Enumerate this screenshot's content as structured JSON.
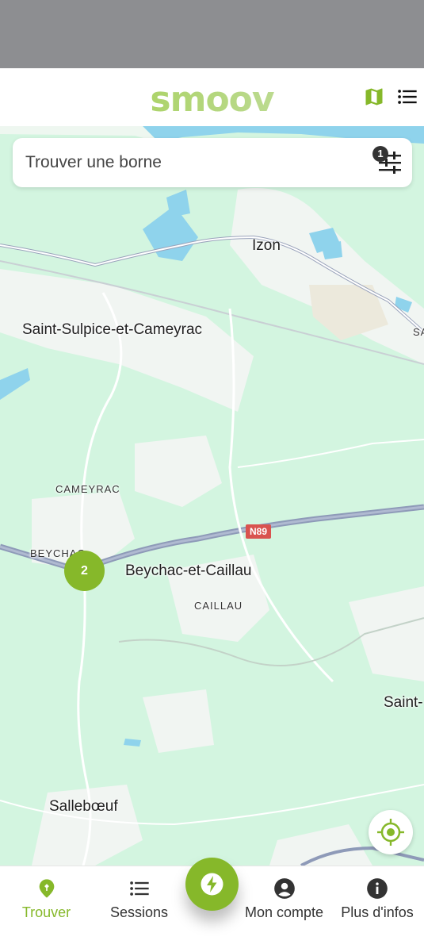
{
  "header": {
    "logo_text": "smoov",
    "brand_color": "#86b82a",
    "icons": [
      "map-icon",
      "list-icon"
    ]
  },
  "search": {
    "placeholder": "Trouver une borne",
    "filter_count": "1"
  },
  "map": {
    "places": [
      "Izon",
      "Saint-Sulpice-et-Cameyrac",
      "CAMEYRAC",
      "BEYCHAC",
      "Beychac-et-Caillau",
      "CAILLAU",
      "Saint-",
      "Sallebœuf",
      "SA"
    ],
    "road_label": "N89",
    "cluster_count": "2"
  },
  "nav": {
    "items": [
      {
        "label": "Trouver",
        "icon": "plug-pin-icon",
        "active": true
      },
      {
        "label": "Sessions",
        "icon": "list-icon",
        "active": false
      },
      {
        "label": "",
        "icon": "lightning-icon",
        "active": false
      },
      {
        "label": "Mon compte",
        "icon": "account-icon",
        "active": false
      },
      {
        "label": "Plus d'infos",
        "icon": "info-icon",
        "active": false
      }
    ]
  }
}
